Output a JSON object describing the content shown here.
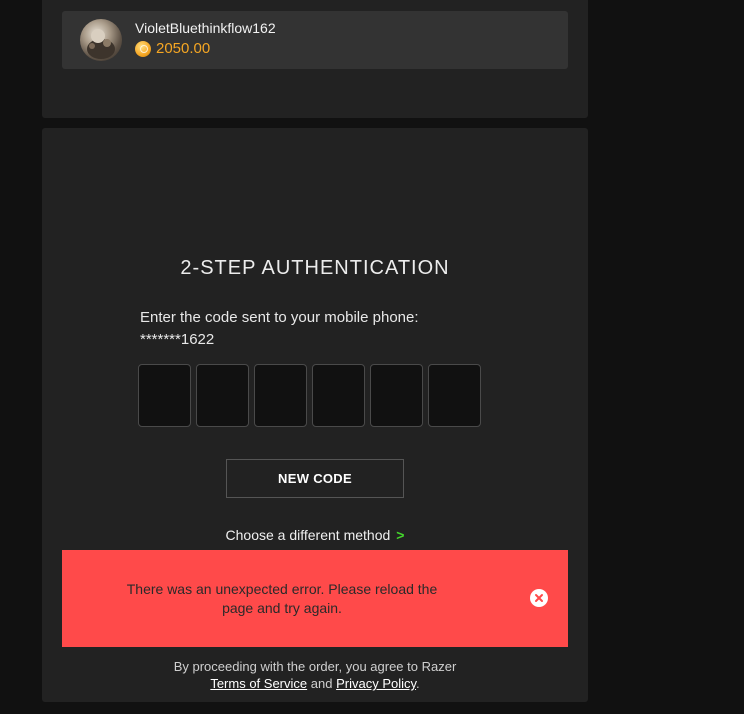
{
  "user": {
    "name": "VioletBluethinkflow162",
    "balance": "2050.00"
  },
  "auth": {
    "title": "2-STEP AUTHENTICATION",
    "instruction": "Enter the code sent to your mobile phone:",
    "phone_masked": "*******1622",
    "code_values": [
      "",
      "",
      "",
      "",
      "",
      ""
    ],
    "new_code_label": "NEW CODE",
    "choose_method_label": "Choose a different method",
    "choose_method_chevron": ">"
  },
  "error": {
    "message": "There was an unexpected error. Please reload the page and try again."
  },
  "footer": {
    "prefix": "By proceeding with the order, you agree to Razer",
    "terms_label": "Terms of Service",
    "and": "and",
    "privacy_label": "Privacy Policy",
    "suffix": "."
  },
  "colors": {
    "accent_green": "#44d62c",
    "gold": "#f5a623",
    "error_red": "#ff4a4a"
  },
  "icons": {
    "coin": "coin-icon",
    "close": "close-icon",
    "chevron": "chevron-right-icon"
  }
}
